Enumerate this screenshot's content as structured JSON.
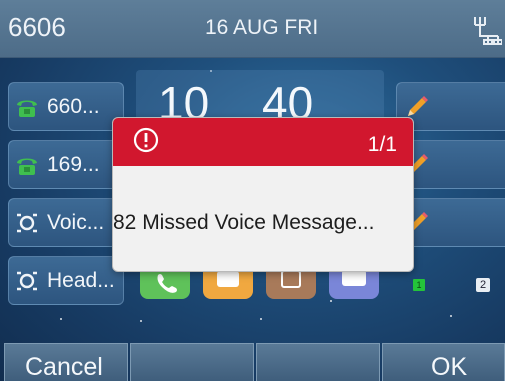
{
  "statusbar": {
    "account": "6606",
    "date": "16 AUG FRI",
    "network_icon": "network-icon"
  },
  "line_keys": [
    {
      "label": "660...",
      "icon": "phone-icon",
      "icon_color": "#3fbf4f"
    },
    {
      "label": "169...",
      "icon": "phone-icon",
      "icon_color": "#3fbf4f"
    },
    {
      "label": "Voic...",
      "icon": "voicemail-icon"
    },
    {
      "label": "Head...",
      "icon": "headset-icon"
    }
  ],
  "clock": {
    "hour": "10",
    "minute": "40"
  },
  "popup": {
    "page": "1/1",
    "message": "82 Missed Voice Message...",
    "icon": "alert-icon",
    "header_color": "#d1172e"
  },
  "indicators": {
    "green_led": "1",
    "page_two": "2"
  },
  "softkeys": {
    "cancel": "Cancel",
    "ok": "OK"
  }
}
